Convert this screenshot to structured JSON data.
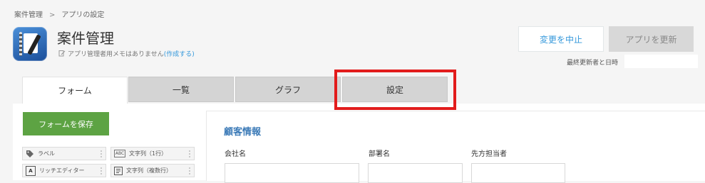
{
  "breadcrumb": {
    "parent": "案件管理",
    "separator": ">",
    "current": "アプリの設定"
  },
  "app": {
    "title": "案件管理",
    "memo_text": "アプリ管理者用メモはありません",
    "memo_create_link": "(作成する)"
  },
  "actions": {
    "cancel_label": "変更を中止",
    "update_label": "アプリを更新"
  },
  "last_updated_label": "最終更新者と日時",
  "tabs": [
    {
      "label": "フォーム",
      "active": true
    },
    {
      "label": "一覧",
      "active": false
    },
    {
      "label": "グラフ",
      "active": false
    },
    {
      "label": "設定",
      "active": false,
      "highlighted": true
    }
  ],
  "form": {
    "save_label": "フォームを保存",
    "palette": [
      {
        "icon": "tag-icon",
        "label": "ラベル"
      },
      {
        "icon": "abc-icon",
        "label": "文字列（1行）"
      },
      {
        "icon": "rich-text-icon",
        "label": "リッチエディター"
      },
      {
        "icon": "multiline-text-icon",
        "label": "文字列（複数行）"
      }
    ],
    "section_title": "顧客情報",
    "fields": [
      {
        "label": "会社名"
      },
      {
        "label": "部署名"
      },
      {
        "label": "先方担当者"
      }
    ]
  },
  "colors": {
    "accent_blue": "#3498db",
    "save_green": "#5da343",
    "highlight_red": "#e21c1c",
    "section_blue": "#3b7ab7"
  }
}
